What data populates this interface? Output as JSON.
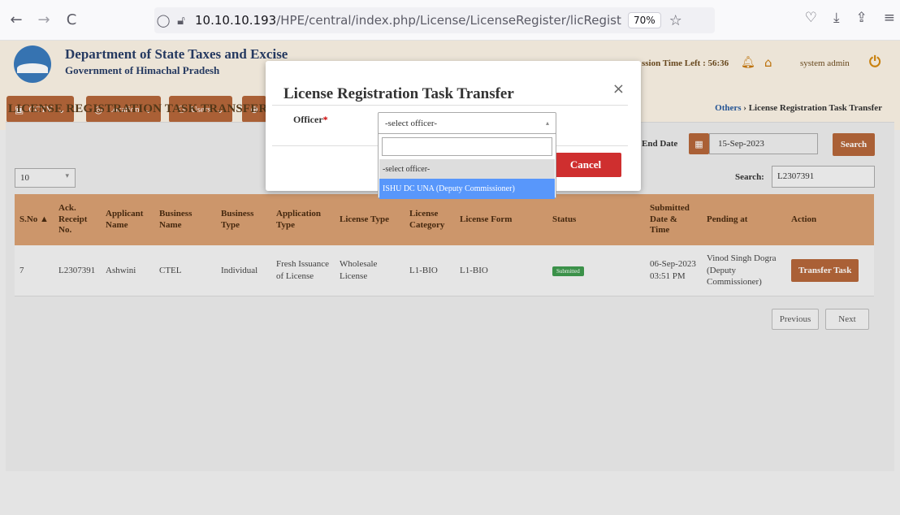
{
  "browser": {
    "back": "←",
    "forward": "→",
    "reload": "C",
    "url_host": "10.10.10.193",
    "url_path": "/HPE/central/index.php/License/LicenseRegister/licRegisterTaskTra",
    "zoom": "70%"
  },
  "header": {
    "title": "Department of State Taxes and Excise",
    "subtitle": "Government of Himachal Pradesh",
    "session": "ssion Time Left : 56:36",
    "user": "system admin"
  },
  "menu": [
    {
      "label": "CCTV"
    },
    {
      "label": "Location"
    },
    {
      "label": "Users"
    }
  ],
  "page": {
    "title": "LICENSE REGISTRATION TASK TRANSFER",
    "breadcrumb_link": "Others",
    "breadcrumb_sep": "›",
    "breadcrumb_current": "License Registration Task Transfer"
  },
  "filters": {
    "end_date_label": "End Date",
    "end_date_value": "15-Sep-2023",
    "search_button": "Search",
    "page_length": "10",
    "search_label": "Search:",
    "search_value": "L2307391"
  },
  "table": {
    "headers": [
      "S.No ▲",
      "Ack. Receipt No.",
      "Applicant Name",
      "Business Name",
      "Business Type",
      "Application Type",
      "License Type",
      "License Category",
      "License Form",
      "Status",
      "Submitted Date & Time",
      "Pending at",
      "Action"
    ],
    "row": {
      "sno": "7",
      "ack": "L2307391",
      "applicant": "Ashwini",
      "business": "CTEL",
      "business_type": "Individual",
      "application_type": "Fresh Issuance of License",
      "license_type": "Wholesale License",
      "license_category": "L1-BIO",
      "license_form": "L1-BIO",
      "status": "Submitted",
      "submitted": "06-Sep-2023 03:51 PM",
      "pending_at": "Vinod Singh Dogra (Deputy Commissioner)",
      "action": "Transfer Task"
    }
  },
  "pagination": {
    "previous": "Previous",
    "next": "Next"
  },
  "modal": {
    "title": "License Registration Task Transfer",
    "close": "×",
    "officer_label": "Officer",
    "required": "*",
    "select_value": "-select officer-",
    "cancel": "Cancel",
    "options": [
      "-select officer-",
      "ISHU DC UNA (Deputy Commissioner)"
    ]
  }
}
